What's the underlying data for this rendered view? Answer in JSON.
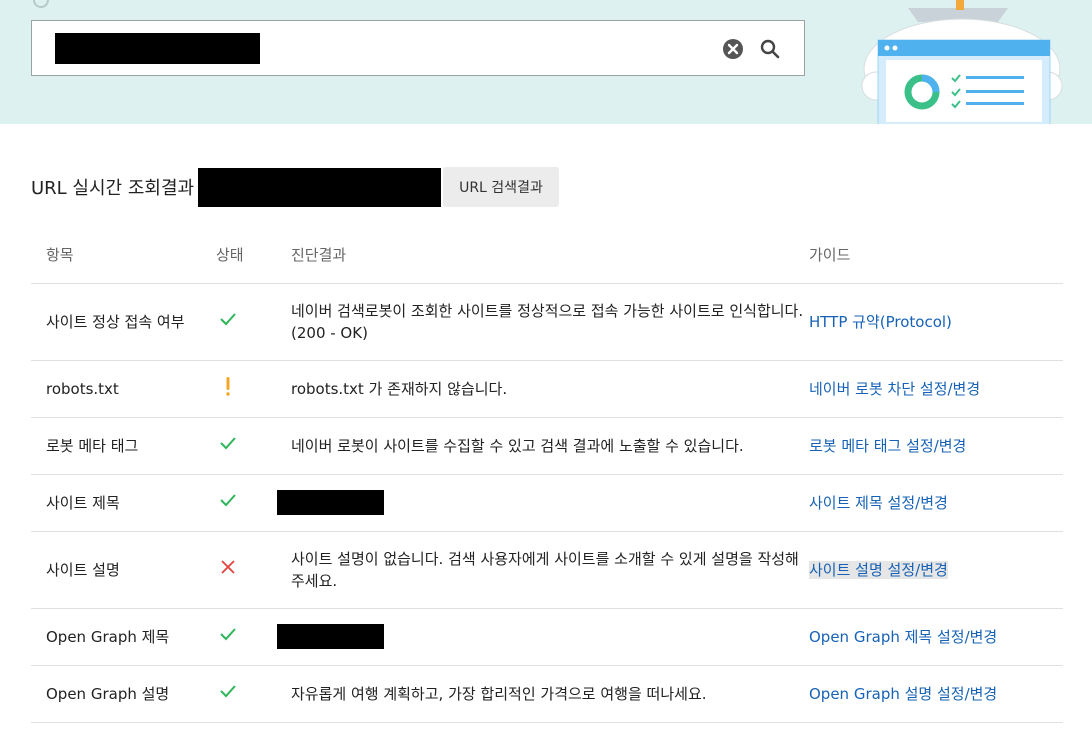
{
  "search": {
    "clear_icon": "clear-icon",
    "search_icon": "search-icon",
    "value": "[redacted]"
  },
  "section": {
    "title": "URL 실시간 조회결과",
    "url_button": "URL 검색결과"
  },
  "table": {
    "headers": {
      "item": "항목",
      "status": "상태",
      "result": "진단결과",
      "guide": "가이드"
    },
    "rows": [
      {
        "item": "사이트 정상 접속 여부",
        "status": "ok",
        "result_line1": "네이버 검색로봇이 조회한 사이트를 정상적으로 접속 가능한 사이트로 인식합니다.",
        "result_line2": "(200 - OK)",
        "guide": "HTTP 규약(Protocol)"
      },
      {
        "item": "robots.txt",
        "status": "warning",
        "result_line1": "robots.txt 가 존재하지 않습니다.",
        "guide": "네이버 로봇 차단 설정/변경"
      },
      {
        "item": "로봇 메타 태그",
        "status": "ok",
        "result_line1": "네이버 로봇이 사이트를 수집할 수 있고 검색 결과에 노출할 수 있습니다.",
        "guide": "로봇 메타 태그 설정/변경"
      },
      {
        "item": "사이트 제목",
        "status": "ok",
        "result_line1": "[redacted]",
        "guide": "사이트 제목 설정/변경"
      },
      {
        "item": "사이트 설명",
        "status": "error",
        "result_line1": "사이트 설명이 없습니다. 검색 사용자에게 사이트를 소개할 수 있게 설명을 작성해",
        "result_line2": "주세요.",
        "guide": "사이트 설명 설정/변경"
      },
      {
        "item": "Open Graph 제목",
        "status": "ok",
        "result_line1": "[redacted]",
        "guide": "Open Graph 제목 설정/변경"
      },
      {
        "item": "Open Graph 설명",
        "status": "ok",
        "result_line1": "자유롭게 여행 계획하고, 가장 합리적인 가격으로 여행을 떠나세요.",
        "guide": "Open Graph 설명 설정/변경"
      }
    ]
  },
  "colors": {
    "hero_bg": "#ddf2f0",
    "ok": "#2fb55a",
    "warning": "#f5a623",
    "error": "#e8423f",
    "link": "#1762b6"
  }
}
